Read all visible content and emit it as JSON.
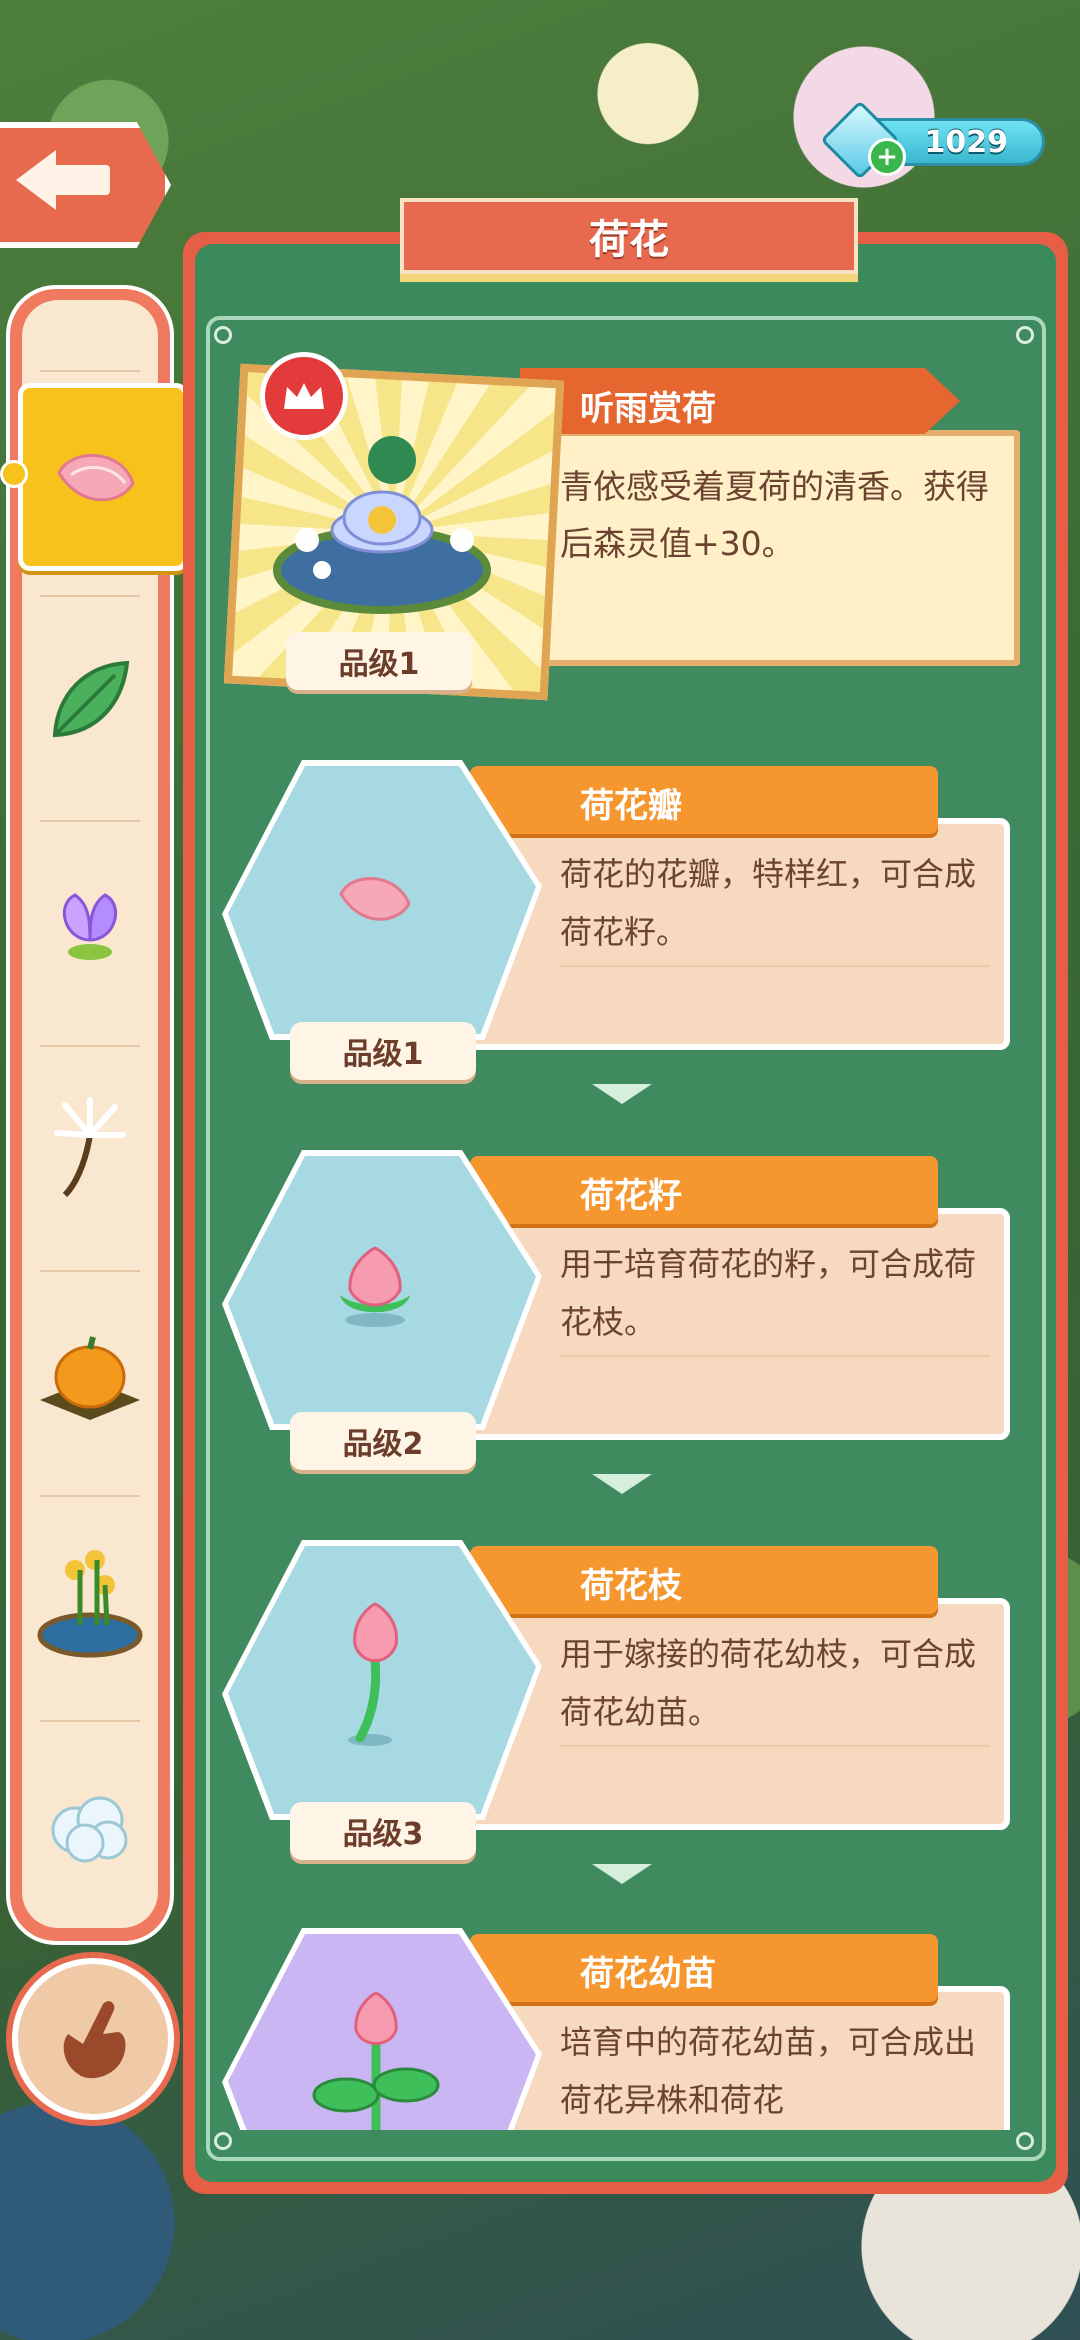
{
  "header": {
    "title": "荷花",
    "gem_count": "1029",
    "back_icon": "back-arrow-icon",
    "gem_icon": "diamond-icon",
    "add_icon": "plus-icon"
  },
  "sidebar": {
    "items": [
      {
        "icon": "petal-icon",
        "active": true
      },
      {
        "icon": "leaf-icon"
      },
      {
        "icon": "butterfly-leaf-icon"
      },
      {
        "icon": "dandelion-sprout-icon"
      },
      {
        "icon": "pumpkin-icon"
      },
      {
        "icon": "pond-flowers-icon"
      },
      {
        "icon": "cotton-flower-icon"
      }
    ],
    "bottom_icon": "hand-pointer-icon"
  },
  "featured": {
    "name": "听雨赏荷",
    "description": "青依感受着夏荷的清香。获得后森灵值+30。",
    "grade": "品级1",
    "badge_icon": "crown-icon"
  },
  "items": [
    {
      "name": "荷花瓣",
      "description": "荷花的花瓣，特样红，可合成荷花籽。",
      "grade": "品级1",
      "icon": "lotus-petal-icon"
    },
    {
      "name": "荷花籽",
      "description": "用于培育荷花的籽，可合成荷花枝。",
      "grade": "品级2",
      "icon": "lotus-bud-icon"
    },
    {
      "name": "荷花枝",
      "description": "用于嫁接的荷花幼枝，可合成荷花幼苗。",
      "grade": "品级3",
      "icon": "lotus-stem-icon"
    },
    {
      "name": "荷花幼苗",
      "description": "培育中的荷花幼苗，可合成出荷花异株和荷花",
      "grade": "",
      "icon": "lotus-seedling-icon"
    }
  ],
  "colors": {
    "accent_red": "#e7694e",
    "panel_green": "#3f8a5f",
    "tab_orange": "#f5962f",
    "sidebar_active": "#f8c21c"
  }
}
